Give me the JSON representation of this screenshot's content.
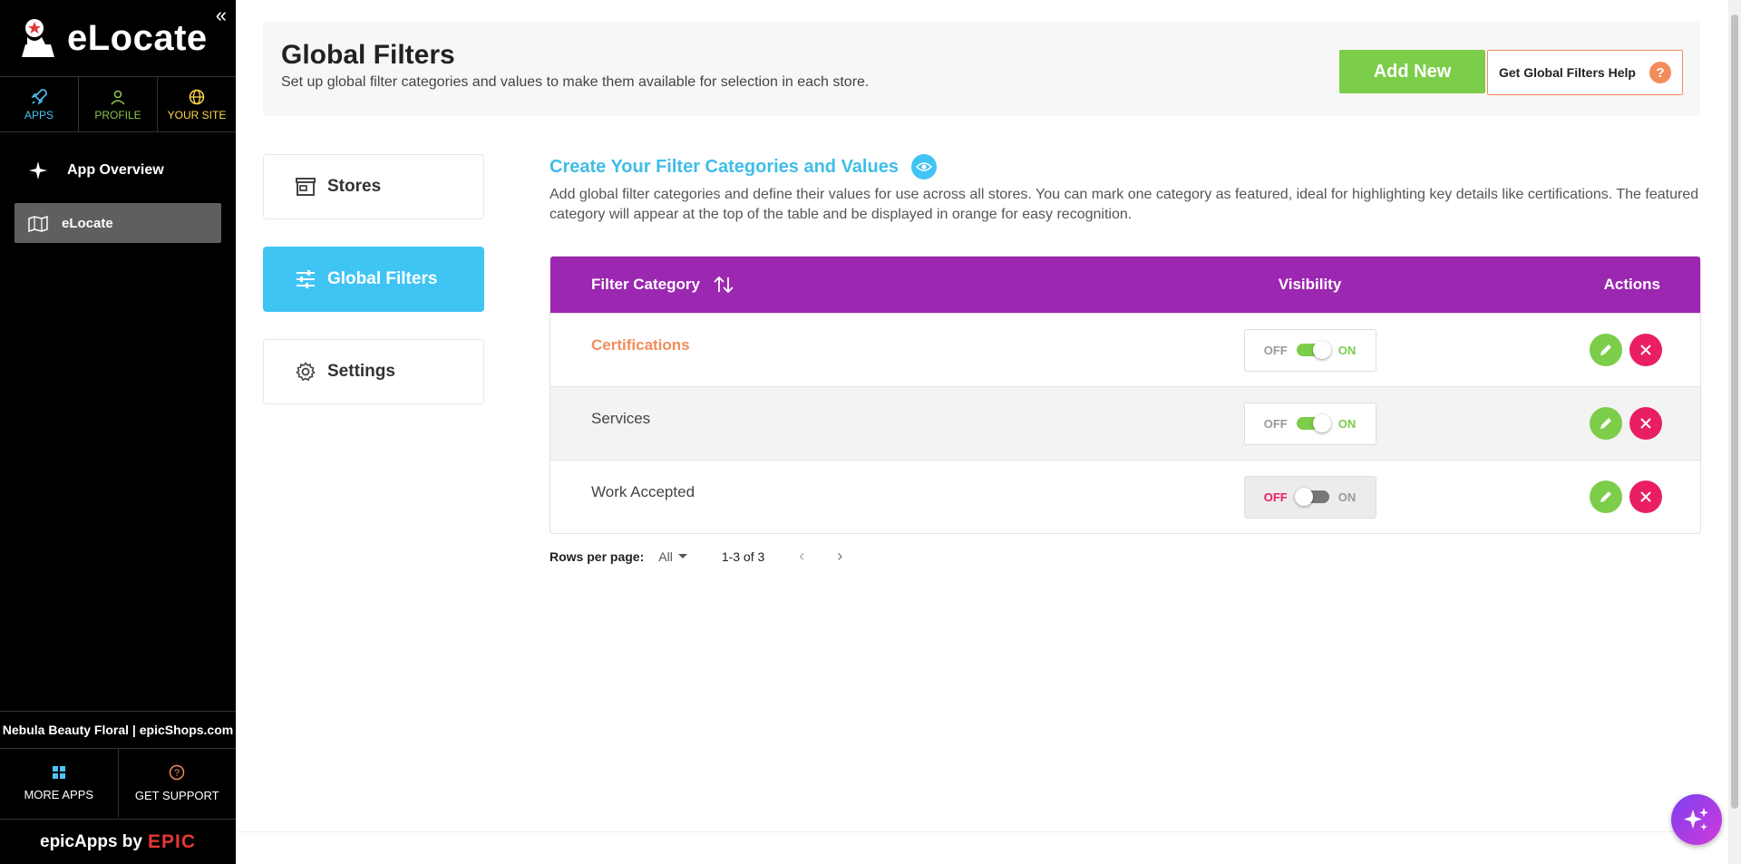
{
  "sidebar": {
    "app_title": "eLocate",
    "topnav": [
      {
        "label": "APPS",
        "icon": "rocket-icon",
        "color": "#4fc3f7"
      },
      {
        "label": "PROFILE",
        "icon": "user-icon",
        "color": "#8bc34a"
      },
      {
        "label": "YOUR SITE",
        "icon": "globe-icon",
        "color": "#ffd54f"
      }
    ],
    "menu": [
      {
        "label": "App Overview",
        "icon": "sparkle-icon"
      },
      {
        "label": "eLocate",
        "icon": "map-icon",
        "active": true
      }
    ],
    "shop_name": "Nebula Beauty Floral | epicShops.com",
    "bottomnav": [
      {
        "label": "MORE APPS",
        "icon": "grid-icon"
      },
      {
        "label": "GET SUPPORT",
        "icon": "help-circle-icon"
      }
    ],
    "brand_prefix": "epicApps by",
    "brand_name": "EPIC"
  },
  "header": {
    "title": "Global Filters",
    "subtitle": "Set up global filter categories and values to make them available for selection in each store.",
    "add_label": "Add New",
    "help_label": "Get Global Filters Help",
    "help_glyph": "?"
  },
  "tabs": [
    {
      "label": "Stores",
      "icon": "store-icon"
    },
    {
      "label": "Global Filters",
      "icon": "sliders-icon",
      "active": true
    },
    {
      "label": "Settings",
      "icon": "gear-icon"
    }
  ],
  "section": {
    "title": "Create Your Filter Categories and Values",
    "description": "Add global filter categories and define their values for use across all stores. You can mark one category as featured, ideal for highlighting key details like certifications. The featured category will appear at the top of the table and be displayed in orange for easy recognition."
  },
  "table": {
    "columns": {
      "category": "Filter Category",
      "visibility": "Visibility",
      "actions": "Actions"
    },
    "rows": [
      {
        "category": "Certifications",
        "featured": true,
        "visible": true
      },
      {
        "category": "Services",
        "featured": false,
        "visible": true
      },
      {
        "category": "Work Accepted",
        "featured": false,
        "visible": false
      }
    ],
    "toggle_off": "OFF",
    "toggle_on": "ON"
  },
  "pager": {
    "rows_label": "Rows per page:",
    "rows_value": "All",
    "range": "1-3 of 3"
  },
  "colors": {
    "accent_blue": "#40c4f4",
    "header_purple": "#9c27b0",
    "green": "#7ccd4a",
    "featured_orange": "#f28c5a",
    "delete_pink": "#e91e63"
  }
}
